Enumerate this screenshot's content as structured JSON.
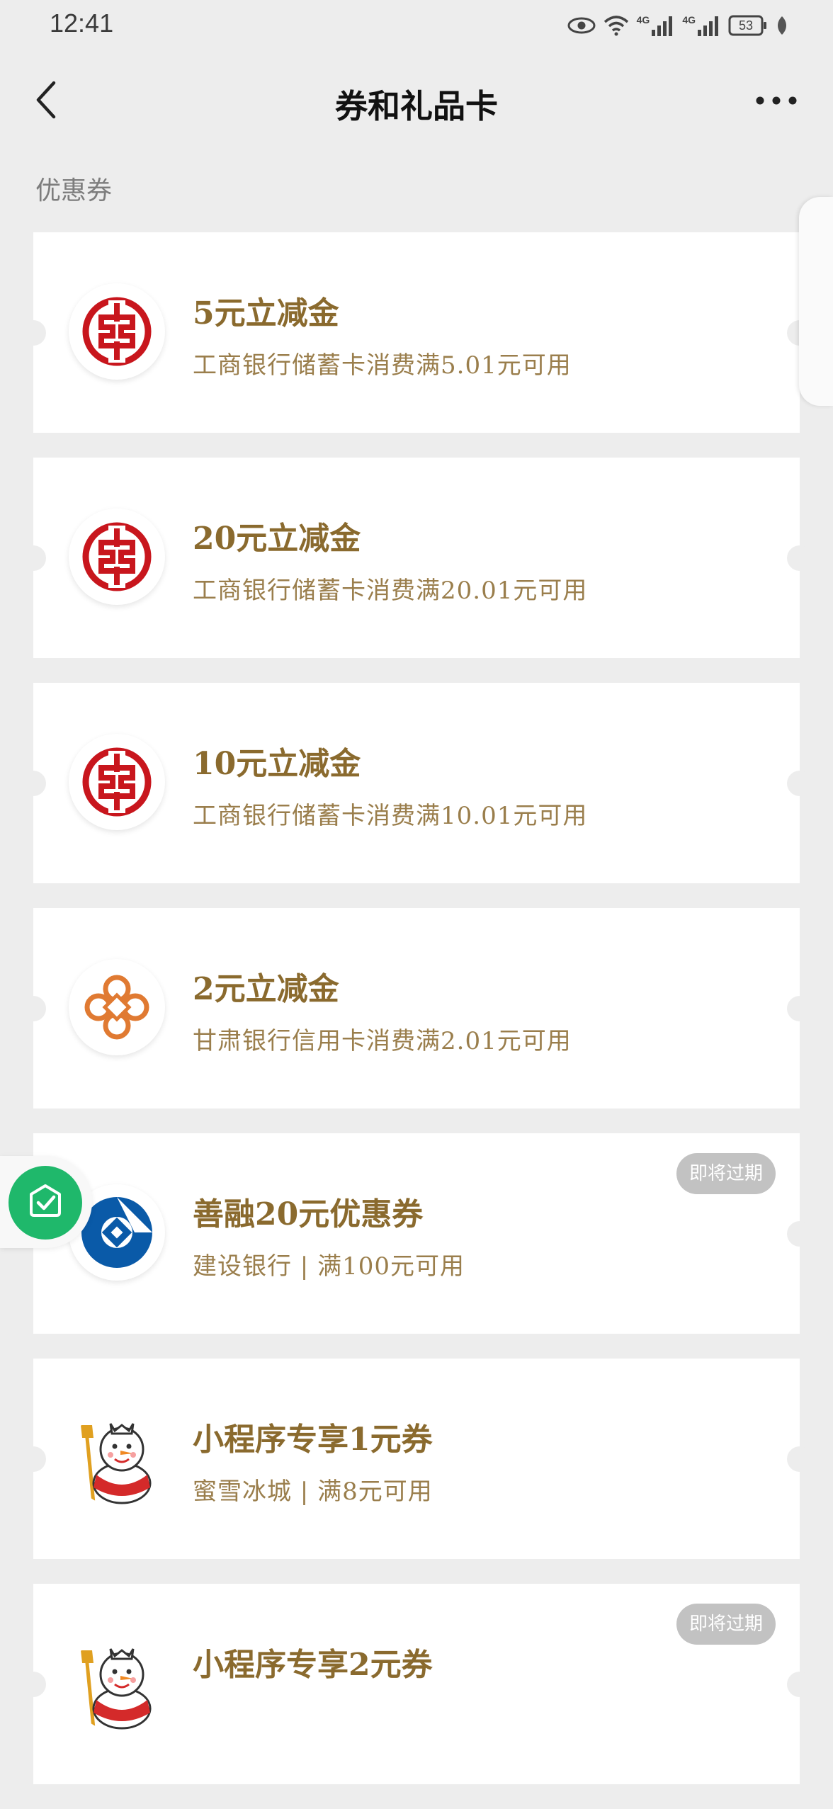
{
  "status_bar": {
    "time": "12:41",
    "network_label_1": "4G",
    "network_label_2": "4G",
    "battery": "53"
  },
  "nav": {
    "title": "券和礼品卡"
  },
  "section": {
    "label": "优惠券"
  },
  "coupons": [
    {
      "title": "5元立减金",
      "desc": "工商银行储蓄卡消费满5.01元可用",
      "logo": "icbc-logo",
      "badge": ""
    },
    {
      "title": "20元立减金",
      "desc": "工商银行储蓄卡消费满20.01元可用",
      "logo": "icbc-logo",
      "badge": ""
    },
    {
      "title": "10元立减金",
      "desc": "工商银行储蓄卡消费满10.01元可用",
      "logo": "icbc-logo",
      "badge": ""
    },
    {
      "title": "2元立减金",
      "desc": "甘肃银行信用卡消费满2.01元可用",
      "logo": "gansu-bank-logo",
      "badge": ""
    },
    {
      "title": "善融20元优惠券",
      "desc": "建设银行 | 满100元可用",
      "logo": "ccb-logo",
      "badge": "即将过期"
    },
    {
      "title": "小程序专享1元券",
      "desc": "蜜雪冰城 | 满8元可用",
      "logo": "mixue-snowman-logo",
      "badge": ""
    },
    {
      "title": "小程序专享2元券",
      "desc": "",
      "logo": "mixue-snowman-logo",
      "badge": "即将过期"
    }
  ],
  "colors": {
    "background": "#ededed",
    "title_gold": "#8a6a2e",
    "desc_gold": "#9a7e4c",
    "icbc_red": "#c8161d",
    "ccb_blue": "#0a5aa8",
    "float_green": "#1fb86b"
  }
}
